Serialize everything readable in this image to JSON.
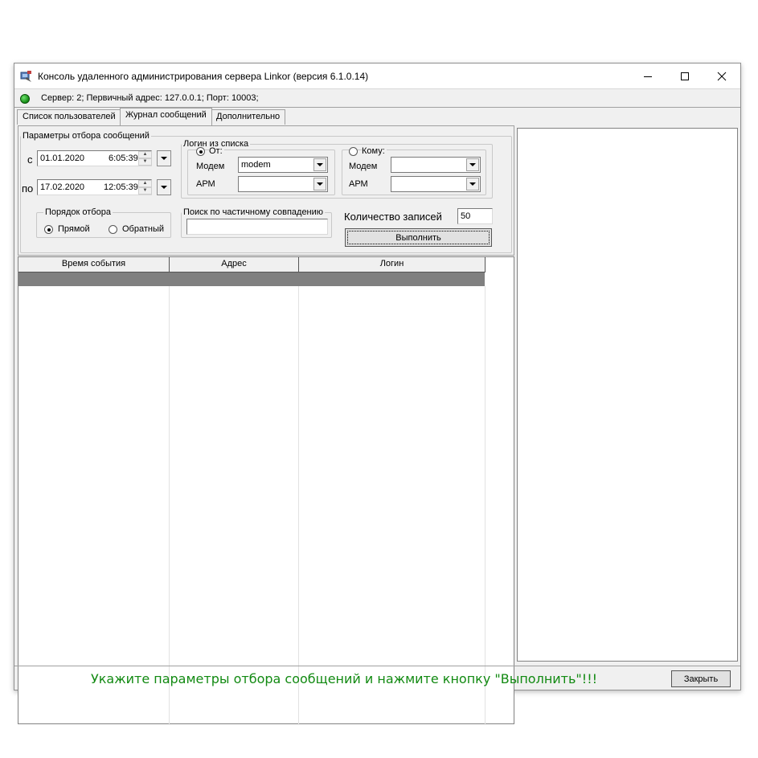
{
  "window": {
    "title": "Консоль удаленного администрирования сервера Linkor (версия 6.1.0.14)",
    "controls": {
      "minimize": "—",
      "maximize": "☐",
      "close": "✕"
    }
  },
  "status": {
    "text": "Сервер: 2; Первичный адрес: 127.0.0.1; Порт: 10003;",
    "indicator_color": "#1a9a1a"
  },
  "tabs": [
    {
      "label": "Список пользователей",
      "active": false
    },
    {
      "label": "Журнал сообщений",
      "active": true
    },
    {
      "label": "Дополнительно",
      "active": false
    }
  ],
  "filter": {
    "legend": "Параметры отбора сообщений",
    "from": {
      "label": "с",
      "date": "01.01.2020",
      "time": "6:05:39"
    },
    "to": {
      "label": "по",
      "date": "17.02.2020",
      "time": "12:05:39"
    },
    "login_group": {
      "legend": "Логин из списка",
      "from_radio": "От:",
      "to_radio": "Кому:",
      "from_modem_label": "Модем",
      "from_modem_value": "modem",
      "from_arm_label": "АРМ",
      "from_arm_value": "",
      "to_modem_label": "Модем",
      "to_modem_value": "",
      "to_arm_label": "АРМ",
      "to_arm_value": ""
    },
    "order": {
      "legend": "Порядок отбора",
      "direct": "Прямой",
      "reverse": "Обратный",
      "selected": "Прямой"
    },
    "search": {
      "legend": "Поиск по частичному совпадению",
      "value": ""
    },
    "records": {
      "label": "Количество записей",
      "value": "50"
    },
    "execute_label": "Выполнить"
  },
  "grid": {
    "columns": [
      "Время события",
      "Адрес",
      "Логин"
    ],
    "rows": []
  },
  "footer": {
    "hint": "Укажите параметры отбора сообщений и нажмите кнопку \"Выполнить\"!!!",
    "hint_color": "#128a12",
    "close_label": "Закрыть"
  }
}
